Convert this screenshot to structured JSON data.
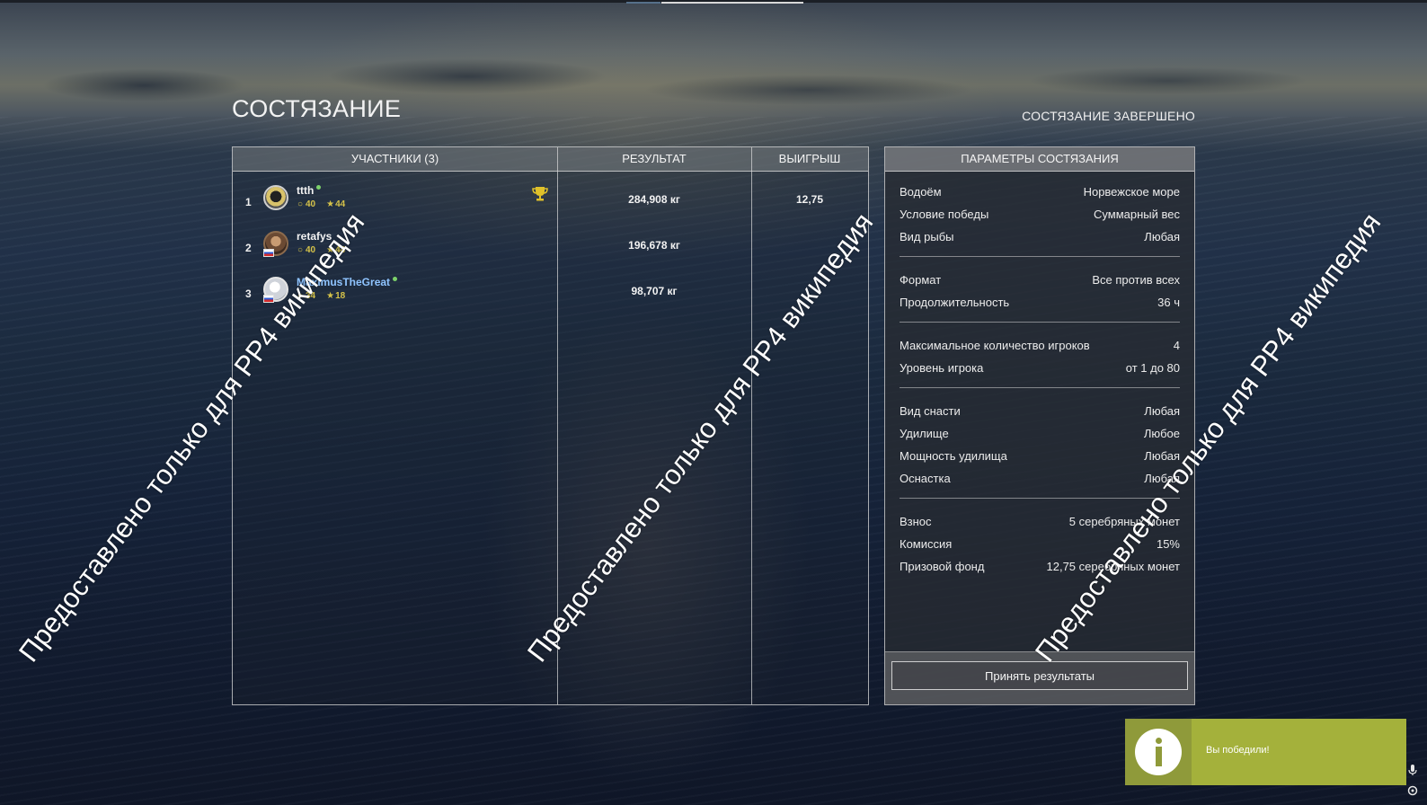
{
  "page": {
    "title": "СОСТЯЗАНИЕ",
    "status": "СОСТЯЗАНИЕ ЗАВЕРШЕНО"
  },
  "participants_table": {
    "columns": [
      "УЧАСТНИКИ (3)",
      "РЕЗУЛЬТАТ",
      "ВЫИГРЫШ"
    ],
    "rows": [
      {
        "rank": "1",
        "name": "ttth",
        "level": "40",
        "rating": "44",
        "result": "284,908 кг",
        "winnings": "12,75",
        "trophy": true,
        "online": true,
        "name_color": "#f2f2f2"
      },
      {
        "rank": "2",
        "name": "retafys",
        "level": "40",
        "rating": "44",
        "result": "196,678 кг",
        "winnings": "",
        "trophy": false,
        "online": false,
        "name_color": "#f2f2f2"
      },
      {
        "rank": "3",
        "name": "MaximusTheGreat",
        "level": "34",
        "rating": "18",
        "result": "98,707 кг",
        "winnings": "",
        "trophy": false,
        "online": true,
        "name_color": "#8fc4ff"
      }
    ]
  },
  "params": {
    "header": "ПАРАМЕТРЫ СОСТЯЗАНИЯ",
    "groups": [
      [
        {
          "label": "Водоём",
          "value": "Норвежское море"
        },
        {
          "label": "Условие победы",
          "value": "Суммарный вес"
        },
        {
          "label": "Вид рыбы",
          "value": "Любая"
        }
      ],
      [
        {
          "label": "Формат",
          "value": "Все против всех"
        },
        {
          "label": "Продолжительность",
          "value": "36 ч"
        }
      ],
      [
        {
          "label": "Максимальное количество игроков",
          "value": "4"
        },
        {
          "label": "Уровень игрока",
          "value": "от 1 до 80"
        }
      ],
      [
        {
          "label": "Вид снасти",
          "value": "Любая"
        },
        {
          "label": "Удилище",
          "value": "Любое"
        },
        {
          "label": "Мощность удилища",
          "value": "Любая"
        },
        {
          "label": "Оснастка",
          "value": "Любая"
        }
      ],
      [
        {
          "label": "Взнос",
          "value": "5 серебряных монет"
        },
        {
          "label": "Комиссия",
          "value": "15%"
        },
        {
          "label": "Призовой фонд",
          "value": "12,75 серебряных монет"
        }
      ]
    ],
    "accept_button": "Принять результаты"
  },
  "notification": {
    "text": "Вы победили!",
    "icon": "info-icon",
    "color": "#a4b13b"
  },
  "watermark": {
    "text": "Предоставлено только для РР4 википедия"
  },
  "icons": {
    "level": "ring-icon",
    "rating": "star-icon",
    "winner": "trophy-icon",
    "mic": "microphone-icon",
    "settings": "gear-icon"
  }
}
